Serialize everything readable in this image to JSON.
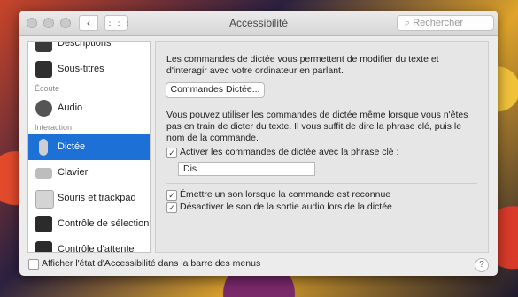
{
  "window": {
    "title": "Accessibilité"
  },
  "toolbar": {
    "back_glyph": "‹",
    "forward_glyph": "›",
    "grid_glyph": "⋮⋮⋮",
    "search_placeholder": "Rechercher"
  },
  "sidebar": {
    "items": [
      {
        "label": "Descriptions",
        "icon": "descriptions-icon"
      },
      {
        "label": "Sous-titres",
        "icon": "subtitles-icon"
      },
      {
        "section": "Écoute"
      },
      {
        "label": "Audio",
        "icon": "speaker-icon"
      },
      {
        "section": "Interaction"
      },
      {
        "label": "Dictée",
        "icon": "microphone-icon",
        "selected": true
      },
      {
        "label": "Clavier",
        "icon": "keyboard-icon"
      },
      {
        "label": "Souris et trackpad",
        "icon": "mouse-icon"
      },
      {
        "label": "Contrôle de sélection",
        "icon": "switch-control-icon"
      },
      {
        "label": "Contrôle d'attente",
        "icon": "dwell-control-icon"
      }
    ]
  },
  "main": {
    "intro": "Les commandes de dictée vous permettent de modifier du texte et d'interagir avec votre ordinateur en parlant.",
    "commands_button": "Commandes Dictée...",
    "phrase_info": "Vous pouvez utiliser les commandes de dictée même lorsque vous n'êtes pas en train de dicter du texte. Il vous suffit de dire la phrase clé, puis le nom de la commande.",
    "phrase_checkbox": "Activer les commandes de dictée avec la phrase clé :",
    "phrase_value": "Dis",
    "sound_checkbox": "Émettre un son lorsque la commande est reconnue",
    "mute_checkbox": "Désactiver le son de la sortie audio lors de la dictée",
    "checkmark": "✓"
  },
  "footer": {
    "menu_checkbox": "Afficher l'état d'Accessibilité dans la barre des menus",
    "help": "?"
  }
}
